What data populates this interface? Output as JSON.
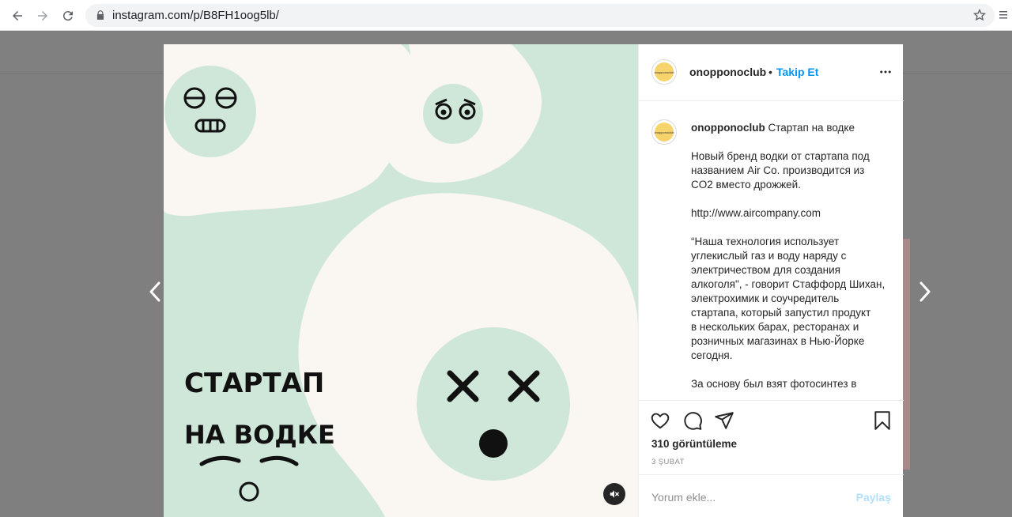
{
  "browser": {
    "url": "instagram.com/p/B8FH1oog5lb/"
  },
  "post": {
    "image_text": {
      "line1": "СТАРТАП",
      "line2": "НА ВОДКЕ"
    },
    "author": {
      "username": "onopponoclub",
      "avatar_text": "onopponoclub"
    },
    "header": {
      "separator": "•",
      "follow_label": "Takip Et"
    },
    "caption": {
      "title": "Стартап на водке",
      "text": "Новый бренд водки от стартапа под названием Air Co. производится из CO2 вместо дрожжей.\n\nhttp://www.aircompany.com\n\n“Наша технология использует углекислый газ и воду наряду с электричеством для создания алкоголя\", - говорит Стаффорд Шихан, электрохимик и соучредитель стартапа, который запустил продукт\nв нескольких барах, ресторанах и розничных магазинах в Нью-Йорке сегодня.\n\nЗа основу был взят фотосинтез в"
    },
    "views": "310 görüntüleme",
    "date": "3 ŞUBAT",
    "comment": {
      "placeholder": "Yorum ekle...",
      "share_label": "Paylaş"
    }
  },
  "colors": {
    "accent": "#0095f6",
    "share_disabled": "#b2dffc",
    "media_green": "#cfe7d9",
    "media_cream": "#faf6f1"
  }
}
